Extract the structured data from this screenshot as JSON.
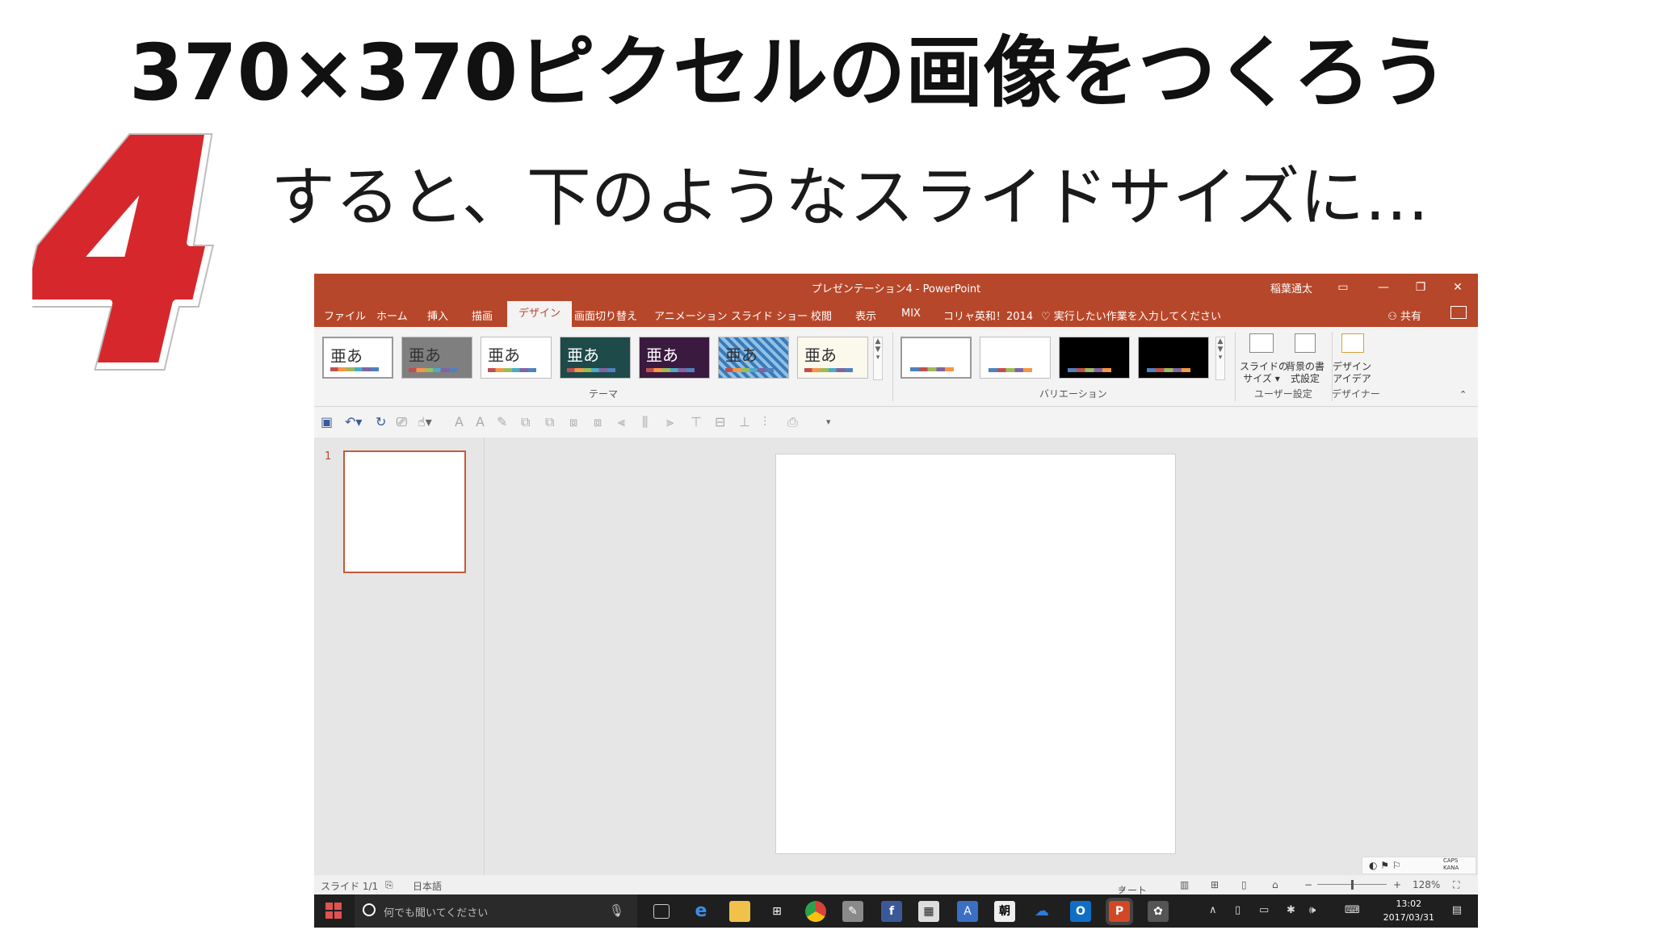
{
  "slide": {
    "title": "370×370ピクセルの画像をつくろう",
    "subtitle": "すると、下のようなスライドサイズに…",
    "step_number": "4"
  },
  "window": {
    "title": "プレゼンテーション4  -  PowerPoint",
    "user": "稲葉通太",
    "controls": {
      "ribbon_display": "▭",
      "minimize": "—",
      "restore": "❐",
      "close": "✕"
    }
  },
  "tabs": [
    "ファイル",
    "ホーム",
    "挿入",
    "描画",
    "デザイン",
    "画面切り替え",
    "アニメーション",
    "スライド ショー",
    "校閲",
    "表示",
    "MIX",
    "コリャ英和！2014"
  ],
  "active_tab": "デザイン",
  "tell_me": "実行したい作業を入力してください",
  "share_label": "共有",
  "ribbon": {
    "theme_thumb_text": "亜あ",
    "group_themes": "テーマ",
    "group_variations": "バリエーション",
    "group_customize": "ユーザー設定",
    "group_designer": "デザイナー",
    "slide_size_label_1": "スライドの",
    "slide_size_label_2": "サイズ ▾",
    "format_bg_label_1": "背景の書",
    "format_bg_label_2": "式設定",
    "design_ideas_label_1": "デザイン",
    "design_ideas_label_2": "アイデア"
  },
  "theme_colors": [
    "#ffffff",
    "#7f7f7f",
    "#ffffff",
    "#1e4a4a",
    "#3a1a3f",
    "#5b9bd5",
    "#fbf8ec"
  ],
  "variation_colors": [
    "#ffffff",
    "#ffffff",
    "#000000",
    "#000000"
  ],
  "thumbnail": {
    "number": "1"
  },
  "status": {
    "slide_info": "スライド 1/1",
    "language": "日本語",
    "notes": "ノート",
    "zoom_level": "128%"
  },
  "ime": {
    "caps": "CAPS",
    "kana": "KANA"
  },
  "taskbar": {
    "search_placeholder": "何でも聞いてください",
    "time": "13:02",
    "date": "2017/03/31"
  }
}
